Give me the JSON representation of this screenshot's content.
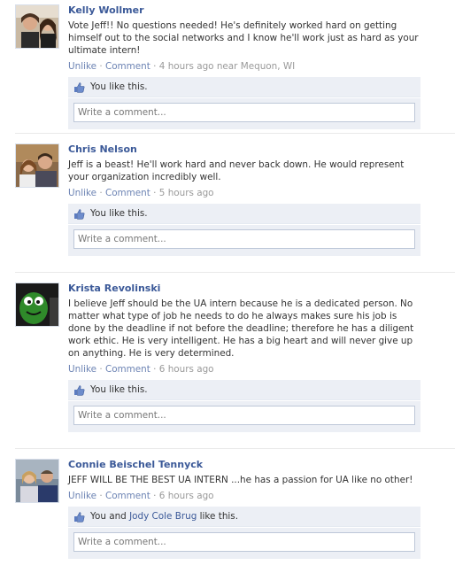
{
  "placeholder": "Write a comment...",
  "posts": [
    {
      "author": "Kelly Wollmer",
      "message": "Vote Jeff!! No questions needed! He's definitely worked hard on getting himself out to the social networks and I know he'll work just as hard as your ultimate intern!",
      "unlike": "Unlike",
      "comment": "Comment",
      "time": "4 hours ago near Mequon, WI",
      "likes_prefix": "You",
      "likes_name": "",
      "likes_suffix": " like this."
    },
    {
      "author": "Chris Nelson",
      "message": "Jeff is a beast! He'll work hard and never back down. He would represent your organization incredibly well.",
      "unlike": "Unlike",
      "comment": "Comment",
      "time": "5 hours ago",
      "likes_prefix": "You",
      "likes_name": "",
      "likes_suffix": " like this."
    },
    {
      "author": "Krista Revolinski",
      "message": "I believe Jeff should be the UA intern because he is a dedicated person. No matter what type of job he needs to do he always makes sure his job is done by the deadline if not before the deadline; therefore he has a diligent work ethic. He is very intelligent. He has a big heart and will never give up on anything. He is very determined.",
      "unlike": "Unlike",
      "comment": "Comment",
      "time": "6 hours ago",
      "likes_prefix": "You",
      "likes_name": "",
      "likes_suffix": " like this."
    },
    {
      "author": "Connie Beischel Tennyck",
      "message": "JEFF WILL BE THE BEST UA INTERN ...he has a passion for UA like no other!",
      "unlike": "Unlike",
      "comment": "Comment",
      "time": "6 hours ago",
      "likes_prefix": "You and ",
      "likes_name": "Jody Cole Brug",
      "likes_suffix": " like this."
    }
  ],
  "colors": {
    "link": "#3b5998",
    "meta_link": "#6d84b4",
    "box_bg": "#eceff5"
  },
  "icons": {
    "like": "thumbs-up-icon"
  }
}
